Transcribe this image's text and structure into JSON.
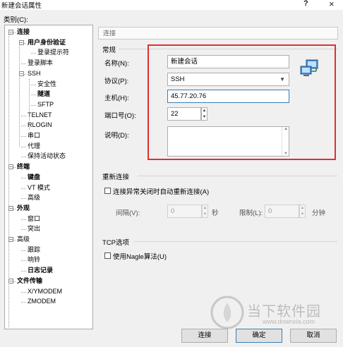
{
  "window": {
    "title": "新建会话属性",
    "help_label": "?",
    "close_label": "×"
  },
  "category_label": "类别(C):",
  "tree": [
    {
      "label": "连接",
      "bold": true,
      "toggle": "−"
    },
    {
      "label": "用户身份验证",
      "bold": true,
      "toggle": "−"
    },
    {
      "label": "登录提示符",
      "bold": false
    },
    {
      "label": "登录脚本",
      "bold": false
    },
    {
      "label": "SSH",
      "bold": false,
      "toggle": "−"
    },
    {
      "label": "安全性",
      "bold": false
    },
    {
      "label": "隧道",
      "bold": true
    },
    {
      "label": "SFTP",
      "bold": false
    },
    {
      "label": "TELNET",
      "bold": false
    },
    {
      "label": "RLOGIN",
      "bold": false
    },
    {
      "label": "串口",
      "bold": false
    },
    {
      "label": "代理",
      "bold": false
    },
    {
      "label": "保持活动状态",
      "bold": false
    },
    {
      "label": "终端",
      "bold": true,
      "toggle": "−"
    },
    {
      "label": "键盘",
      "bold": true
    },
    {
      "label": "VT 模式",
      "bold": false
    },
    {
      "label": "高级",
      "bold": false
    },
    {
      "label": "外观",
      "bold": true,
      "toggle": "−"
    },
    {
      "label": "窗口",
      "bold": false
    },
    {
      "label": "突出",
      "bold": false
    },
    {
      "label": "高级",
      "bold": false,
      "toggle": "−"
    },
    {
      "label": "跟踪",
      "bold": false
    },
    {
      "label": "响铃",
      "bold": false
    },
    {
      "label": "日志记录",
      "bold": true
    },
    {
      "label": "文件传输",
      "bold": true,
      "toggle": "−"
    },
    {
      "label": "X/YMODEM",
      "bold": false
    },
    {
      "label": "ZMODEM",
      "bold": false
    }
  ],
  "section_header": "连接",
  "general": {
    "title": "常规",
    "name_label": "名称(N):",
    "name_value": "新建会话",
    "protocol_label": "协议(P):",
    "protocol_value": "SSH",
    "host_label": "主机(H):",
    "host_value": "45.77.20.76",
    "port_label": "端口号(O):",
    "port_value": "22",
    "desc_label": "说明(D):",
    "desc_value": ""
  },
  "reconnect": {
    "title": "重新连接",
    "auto_label": "连接异常关闭时自动重新连接(A)",
    "interval_label": "间隔(V):",
    "interval_value": "0",
    "seconds_unit": "秒",
    "limit_label": "限制(L):",
    "limit_value": "0",
    "minutes_unit": "分钟"
  },
  "tcp": {
    "title": "TCP选项",
    "nagle_label": "使用Nagle算法(U)"
  },
  "buttons": {
    "connect": "连接",
    "ok": "确定",
    "cancel": "取消"
  },
  "watermark": {
    "brand": "当下软件园",
    "url": "www.downxia.com"
  },
  "colors": {
    "highlight_box": "#e03030",
    "focus_border": "#3c7fb1"
  }
}
